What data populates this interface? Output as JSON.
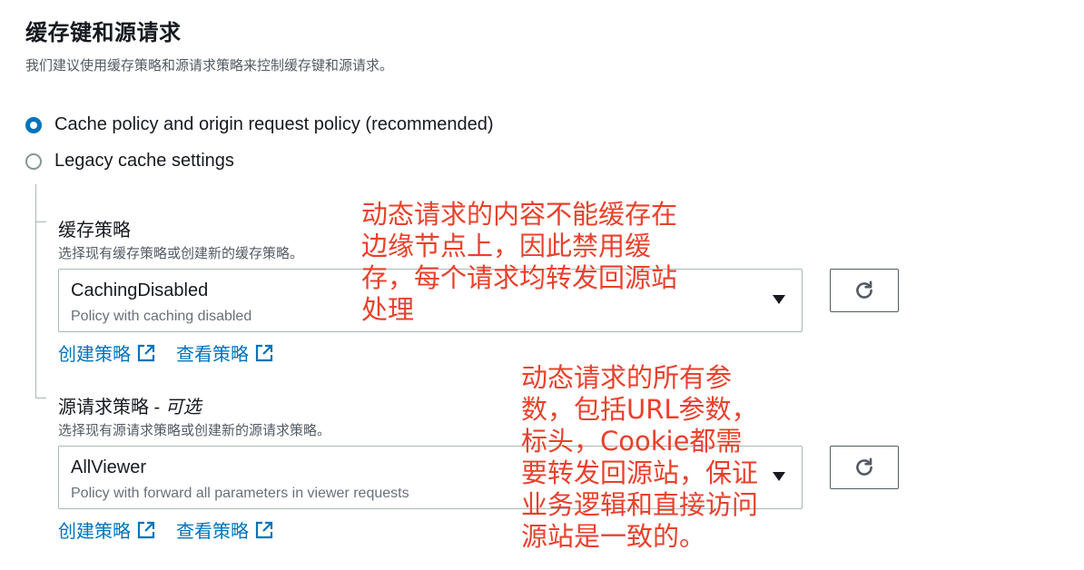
{
  "section": {
    "title": "缓存键和源请求",
    "description": "我们建议使用缓存策略和源请求策略来控制缓存键和源请求。"
  },
  "options": [
    {
      "label": "Cache policy and origin request policy (recommended)",
      "checked": true
    },
    {
      "label": "Legacy cache settings",
      "checked": false
    }
  ],
  "cache_policy": {
    "label": "缓存策略",
    "description": "选择现有缓存策略或创建新的缓存策略。",
    "selected_value": "CachingDisabled",
    "selected_description": "Policy with caching disabled",
    "create_link": "创建策略",
    "view_link": "查看策略"
  },
  "origin_policy": {
    "label": "源请求策略 - ",
    "optional": "可选",
    "description": "选择现有源请求策略或创建新的源请求策略。",
    "selected_value": "AllViewer",
    "selected_description": "Policy with forward all parameters in viewer requests",
    "create_link": "创建策略",
    "view_link": "查看策略"
  },
  "annotations": {
    "note1": "动态请求的内容不能缓存在\n边缘节点上，因此禁用缓\n存，每个请求均转发回源站\n处理",
    "note2": "动态请求的所有参\n数，包括URL参数，\n标头，Cookie都需\n要转发回源站，保证\n业务逻辑和直接访问\n源站是一致的。"
  },
  "colors": {
    "accent": "#0073bb",
    "annotation": "#e8412c",
    "text": "#16191f",
    "muted": "#545b64"
  },
  "icons": {
    "refresh": "refresh-icon",
    "external": "external-link-icon",
    "caret": "caret-down-icon"
  }
}
